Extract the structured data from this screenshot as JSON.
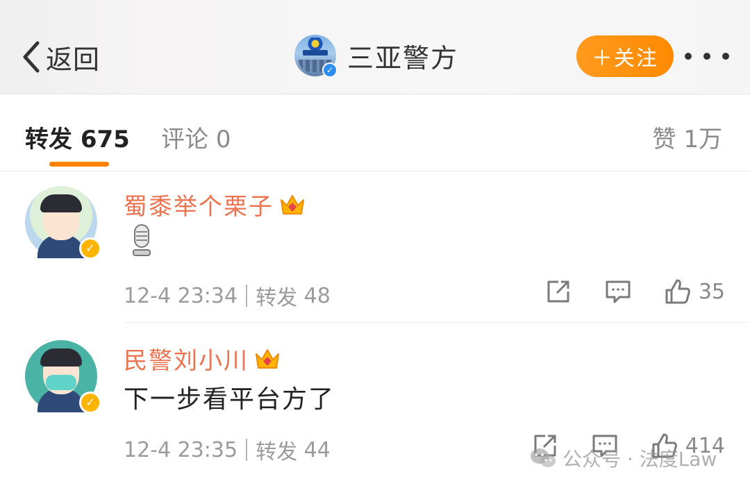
{
  "header": {
    "back_label": "返回",
    "account_name": "三亚警方",
    "follow_label": "＋关注"
  },
  "tabs": {
    "repost_label": "转发",
    "repost_count": "675",
    "comment_label": "评论",
    "comment_count": "0",
    "like_label": "赞",
    "like_count": "1万",
    "active_tab": "repost"
  },
  "reposts": [
    {
      "username": "蜀黍举个栗子",
      "content_icon": "microphone-icon",
      "timestamp": "12-4 23:34",
      "repost_label": "转发",
      "repost_count": "48",
      "likes": "35"
    },
    {
      "username": "民警刘小川",
      "content": "下一步看平台方了",
      "timestamp": "12-4 23:35",
      "repost_label": "转发",
      "repost_count": "44",
      "likes": "414"
    }
  ],
  "watermark": {
    "text": "公众号 · 法度Law"
  },
  "colors": {
    "accent": "#ff8200",
    "username": "#eb7350",
    "verified_yellow": "#ffb400",
    "verified_blue": "#2e8df0"
  }
}
